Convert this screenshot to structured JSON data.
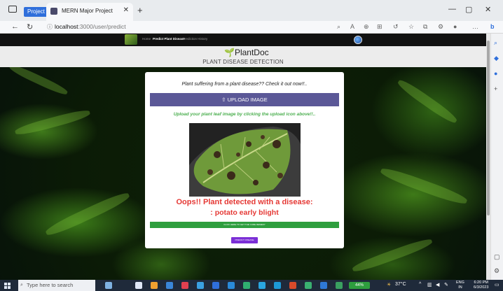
{
  "browser": {
    "profile_label": "Project",
    "tab_title": "MERN Major Project",
    "url_host": "localhost",
    "url_rest": ":3000/user/predict"
  },
  "site": {
    "nav": [
      "Home",
      "Predict Plant Disease",
      "Prediction History"
    ],
    "brand": "PlantDoc",
    "subtitle": "PLANT DISEASE DETECTION"
  },
  "card": {
    "question": "Plant suffering from a plant disease?? Check it out now!!..",
    "upload_label": "⇧ UPLOAD IMAGE",
    "hint": "Upload your plant leaf image by clicking the upload icon above!!..",
    "result_line1": "Oops!! Plant detected with a disease:",
    "result_line2": ": potato early blight",
    "green_bar_label": "CLICK HERE TO GET THE CURE REMEDY",
    "predict_label": "PREDICT DISEASE"
  },
  "taskbar": {
    "search_placeholder": "Type here to search",
    "battery": "44%",
    "temperature": "37°C",
    "lang": "ENG",
    "lang_region": "IN",
    "time": "6:20 PM",
    "date": "6/3/2023"
  },
  "colors": {
    "upload_button": "#5b5897",
    "hint_text": "#4caf50",
    "result_text": "#e53935",
    "green_bar": "#2e9e3e",
    "predict_button": "#7b2fd6"
  }
}
